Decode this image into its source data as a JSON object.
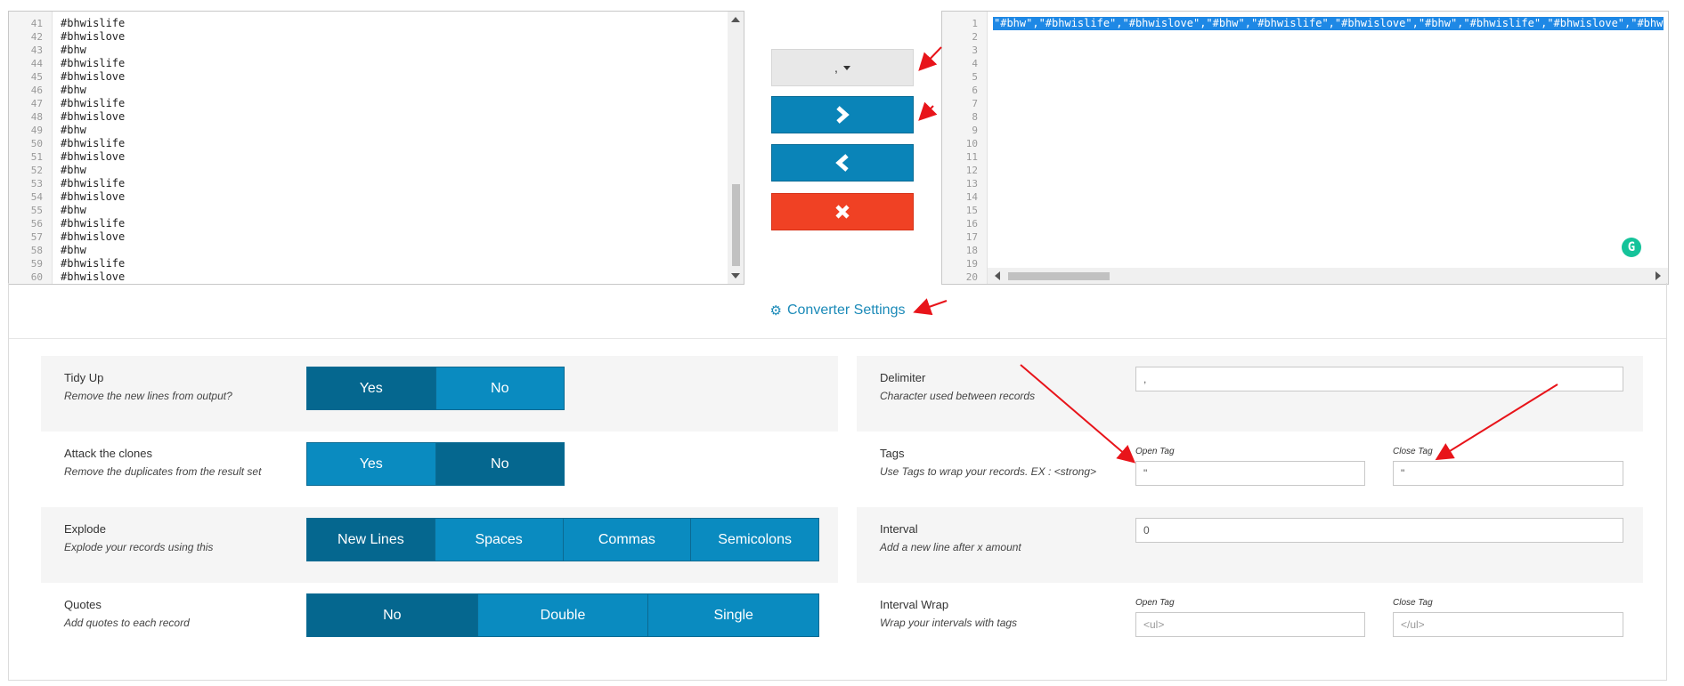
{
  "left_editor": {
    "lines": [
      {
        "n": "41",
        "t": "#bhwislife"
      },
      {
        "n": "42",
        "t": "#bhwislove"
      },
      {
        "n": "43",
        "t": "#bhw"
      },
      {
        "n": "44",
        "t": "#bhwislife"
      },
      {
        "n": "45",
        "t": "#bhwislove"
      },
      {
        "n": "46",
        "t": "#bhw"
      },
      {
        "n": "47",
        "t": "#bhwislife"
      },
      {
        "n": "48",
        "t": "#bhwislove"
      },
      {
        "n": "49",
        "t": "#bhw"
      },
      {
        "n": "50",
        "t": "#bhwislife"
      },
      {
        "n": "51",
        "t": "#bhwislove"
      },
      {
        "n": "52",
        "t": "#bhw"
      },
      {
        "n": "53",
        "t": "#bhwislife"
      },
      {
        "n": "54",
        "t": "#bhwislove"
      },
      {
        "n": "55",
        "t": "#bhw"
      },
      {
        "n": "56",
        "t": "#bhwislife"
      },
      {
        "n": "57",
        "t": "#bhwislove"
      },
      {
        "n": "58",
        "t": "#bhw"
      },
      {
        "n": "59",
        "t": "#bhwislife"
      },
      {
        "n": "60",
        "t": "#bhwislove"
      }
    ]
  },
  "right_editor": {
    "line_numbers": [
      "1",
      "2",
      "3",
      "4",
      "5",
      "6",
      "7",
      "8",
      "9",
      "10",
      "11",
      "12",
      "13",
      "14",
      "15",
      "16",
      "17",
      "18",
      "19",
      "20"
    ],
    "first_line": "\"#bhw\",\"#bhwislife\",\"#bhwislove\",\"#bhw\",\"#bhwislife\",\"#bhwislove\",\"#bhw\",\"#bhwislife\",\"#bhwislove\",\"#bhw",
    "grammarly_icon": "grammarly-icon"
  },
  "controls": {
    "delimiter_value": ",",
    "dropdown_icon": "caret-down-icon",
    "convert_right_icon": "chevron-right-icon",
    "convert_left_icon": "chevron-left-icon",
    "clear_icon": "close-icon"
  },
  "settings": {
    "title": "Converter Settings",
    "tidy_up": {
      "label": "Tidy Up",
      "desc": "Remove the new lines from output?",
      "options": [
        "Yes",
        "No"
      ],
      "active": 0
    },
    "attack_clones": {
      "label": "Attack the clones",
      "desc": "Remove the duplicates from the result set",
      "options": [
        "Yes",
        "No"
      ],
      "active": 1
    },
    "explode": {
      "label": "Explode",
      "desc": "Explode your records using this",
      "options": [
        "New Lines",
        "Spaces",
        "Commas",
        "Semicolons"
      ],
      "active": 0
    },
    "quotes": {
      "label": "Quotes",
      "desc": "Add quotes to each record",
      "options": [
        "No",
        "Double",
        "Single"
      ],
      "active": 0
    },
    "delimiter": {
      "label": "Delimiter",
      "desc": "Character used between records",
      "value": ","
    },
    "tags": {
      "label": "Tags",
      "desc": "Use Tags to wrap your records. EX : <strong>",
      "open_label": "Open Tag",
      "close_label": "Close Tag",
      "open_value": "\"",
      "close_value": "\""
    },
    "interval": {
      "label": "Interval",
      "desc": "Add a new line after x amount",
      "value": "0"
    },
    "interval_wrap": {
      "label": "Interval Wrap",
      "desc": "Wrap your intervals with tags",
      "open_label": "Open Tag",
      "close_label": "Close Tag",
      "open_placeholder": "<ul>",
      "close_placeholder": "</ul>"
    }
  },
  "colors": {
    "accent": "#0a8bc0",
    "accent_dark": "#05678f",
    "danger": "#f04124",
    "annotation": "#e8141a"
  }
}
